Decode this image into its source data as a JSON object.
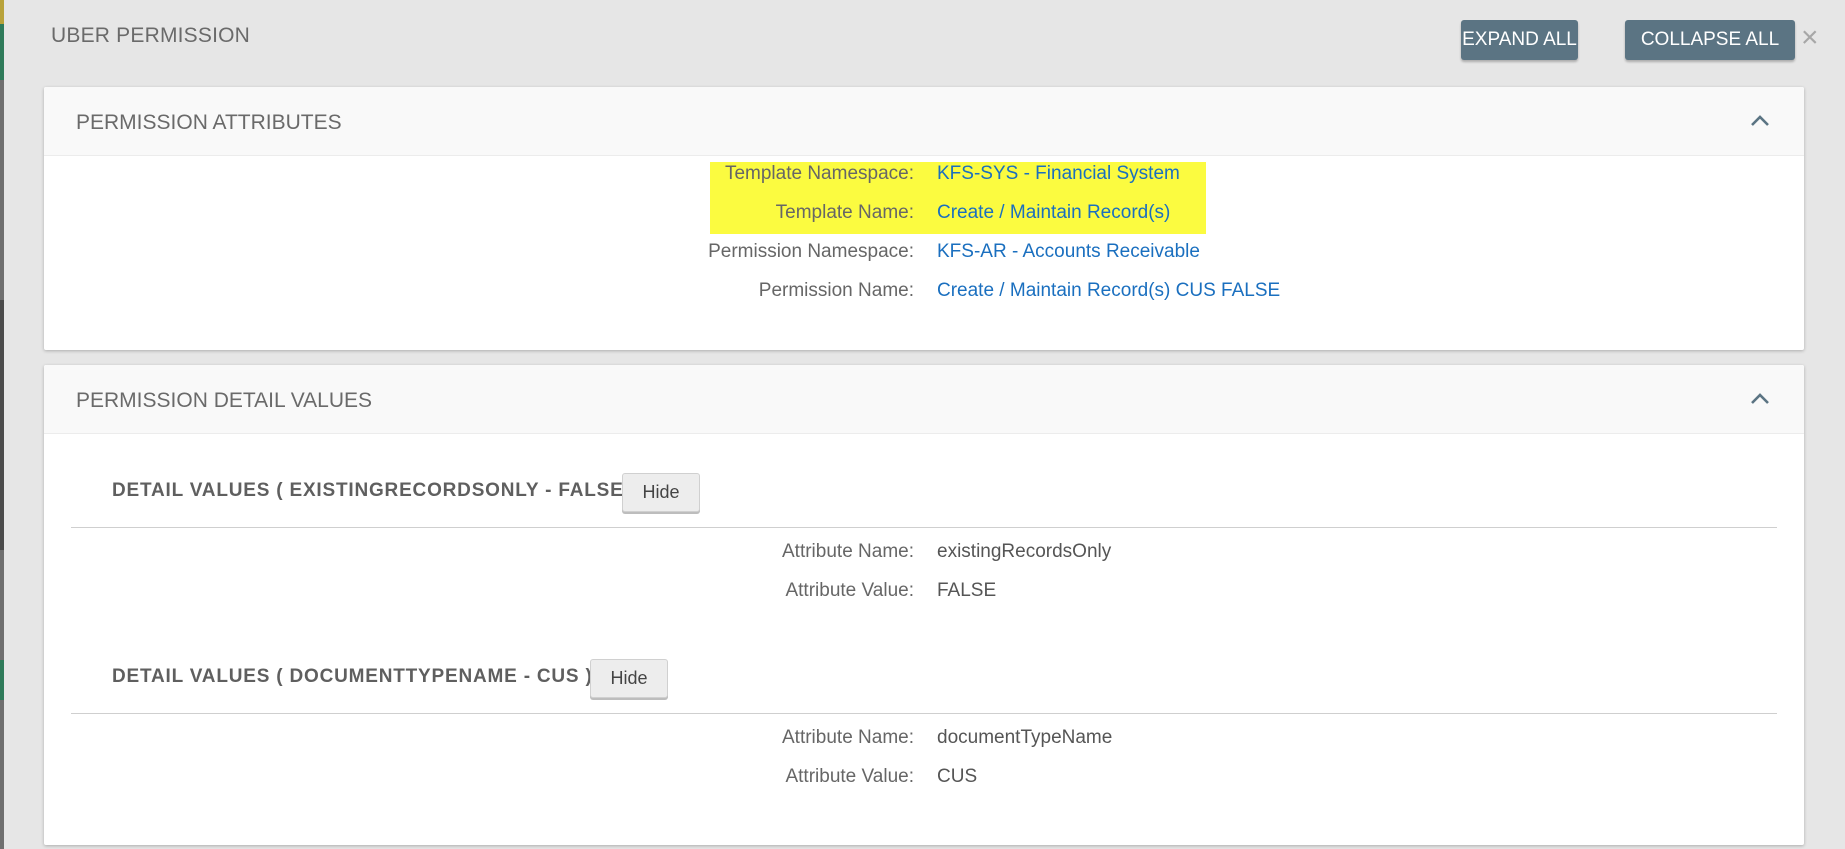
{
  "modal": {
    "title": "UBER PERMISSION",
    "expand_all_label": "EXPAND ALL",
    "collapse_all_label": "COLLAPSE ALL",
    "close_glyph": "×"
  },
  "permission_attributes": {
    "title": "PERMISSION ATTRIBUTES",
    "rows": [
      {
        "label": "Template Namespace:",
        "value": "KFS-SYS - Financial System",
        "highlighted": true
      },
      {
        "label": "Template Name:",
        "value": "Create / Maintain Record(s)",
        "highlighted": true
      },
      {
        "label": "Permission Namespace:",
        "value": "KFS-AR - Accounts Receivable",
        "highlighted": false
      },
      {
        "label": "Permission Name:",
        "value": "Create / Maintain Record(s) CUS FALSE",
        "highlighted": false
      }
    ]
  },
  "permission_detail_values": {
    "title": "PERMISSION DETAIL VALUES",
    "groups": [
      {
        "heading": "DETAIL VALUES ( EXISTINGRECORDSONLY - FALSE )",
        "hide_label": "Hide",
        "attribute_name_label": "Attribute Name:",
        "attribute_name": "existingRecordsOnly",
        "attribute_value_label": "Attribute Value:",
        "attribute_value": "FALSE"
      },
      {
        "heading": "DETAIL VALUES ( DOCUMENTTYPENAME - CUS )",
        "hide_label": "Hide",
        "attribute_name_label": "Attribute Name:",
        "attribute_name": "documentTypeName",
        "attribute_value_label": "Attribute Value:",
        "attribute_value": "CUS"
      }
    ]
  },
  "colors": {
    "highlight": "#fbfb40",
    "link": "#1a6fbf",
    "button": "#5b7483"
  },
  "icons": {
    "close": "close-icon",
    "collapse": "chevron-up-icon"
  }
}
